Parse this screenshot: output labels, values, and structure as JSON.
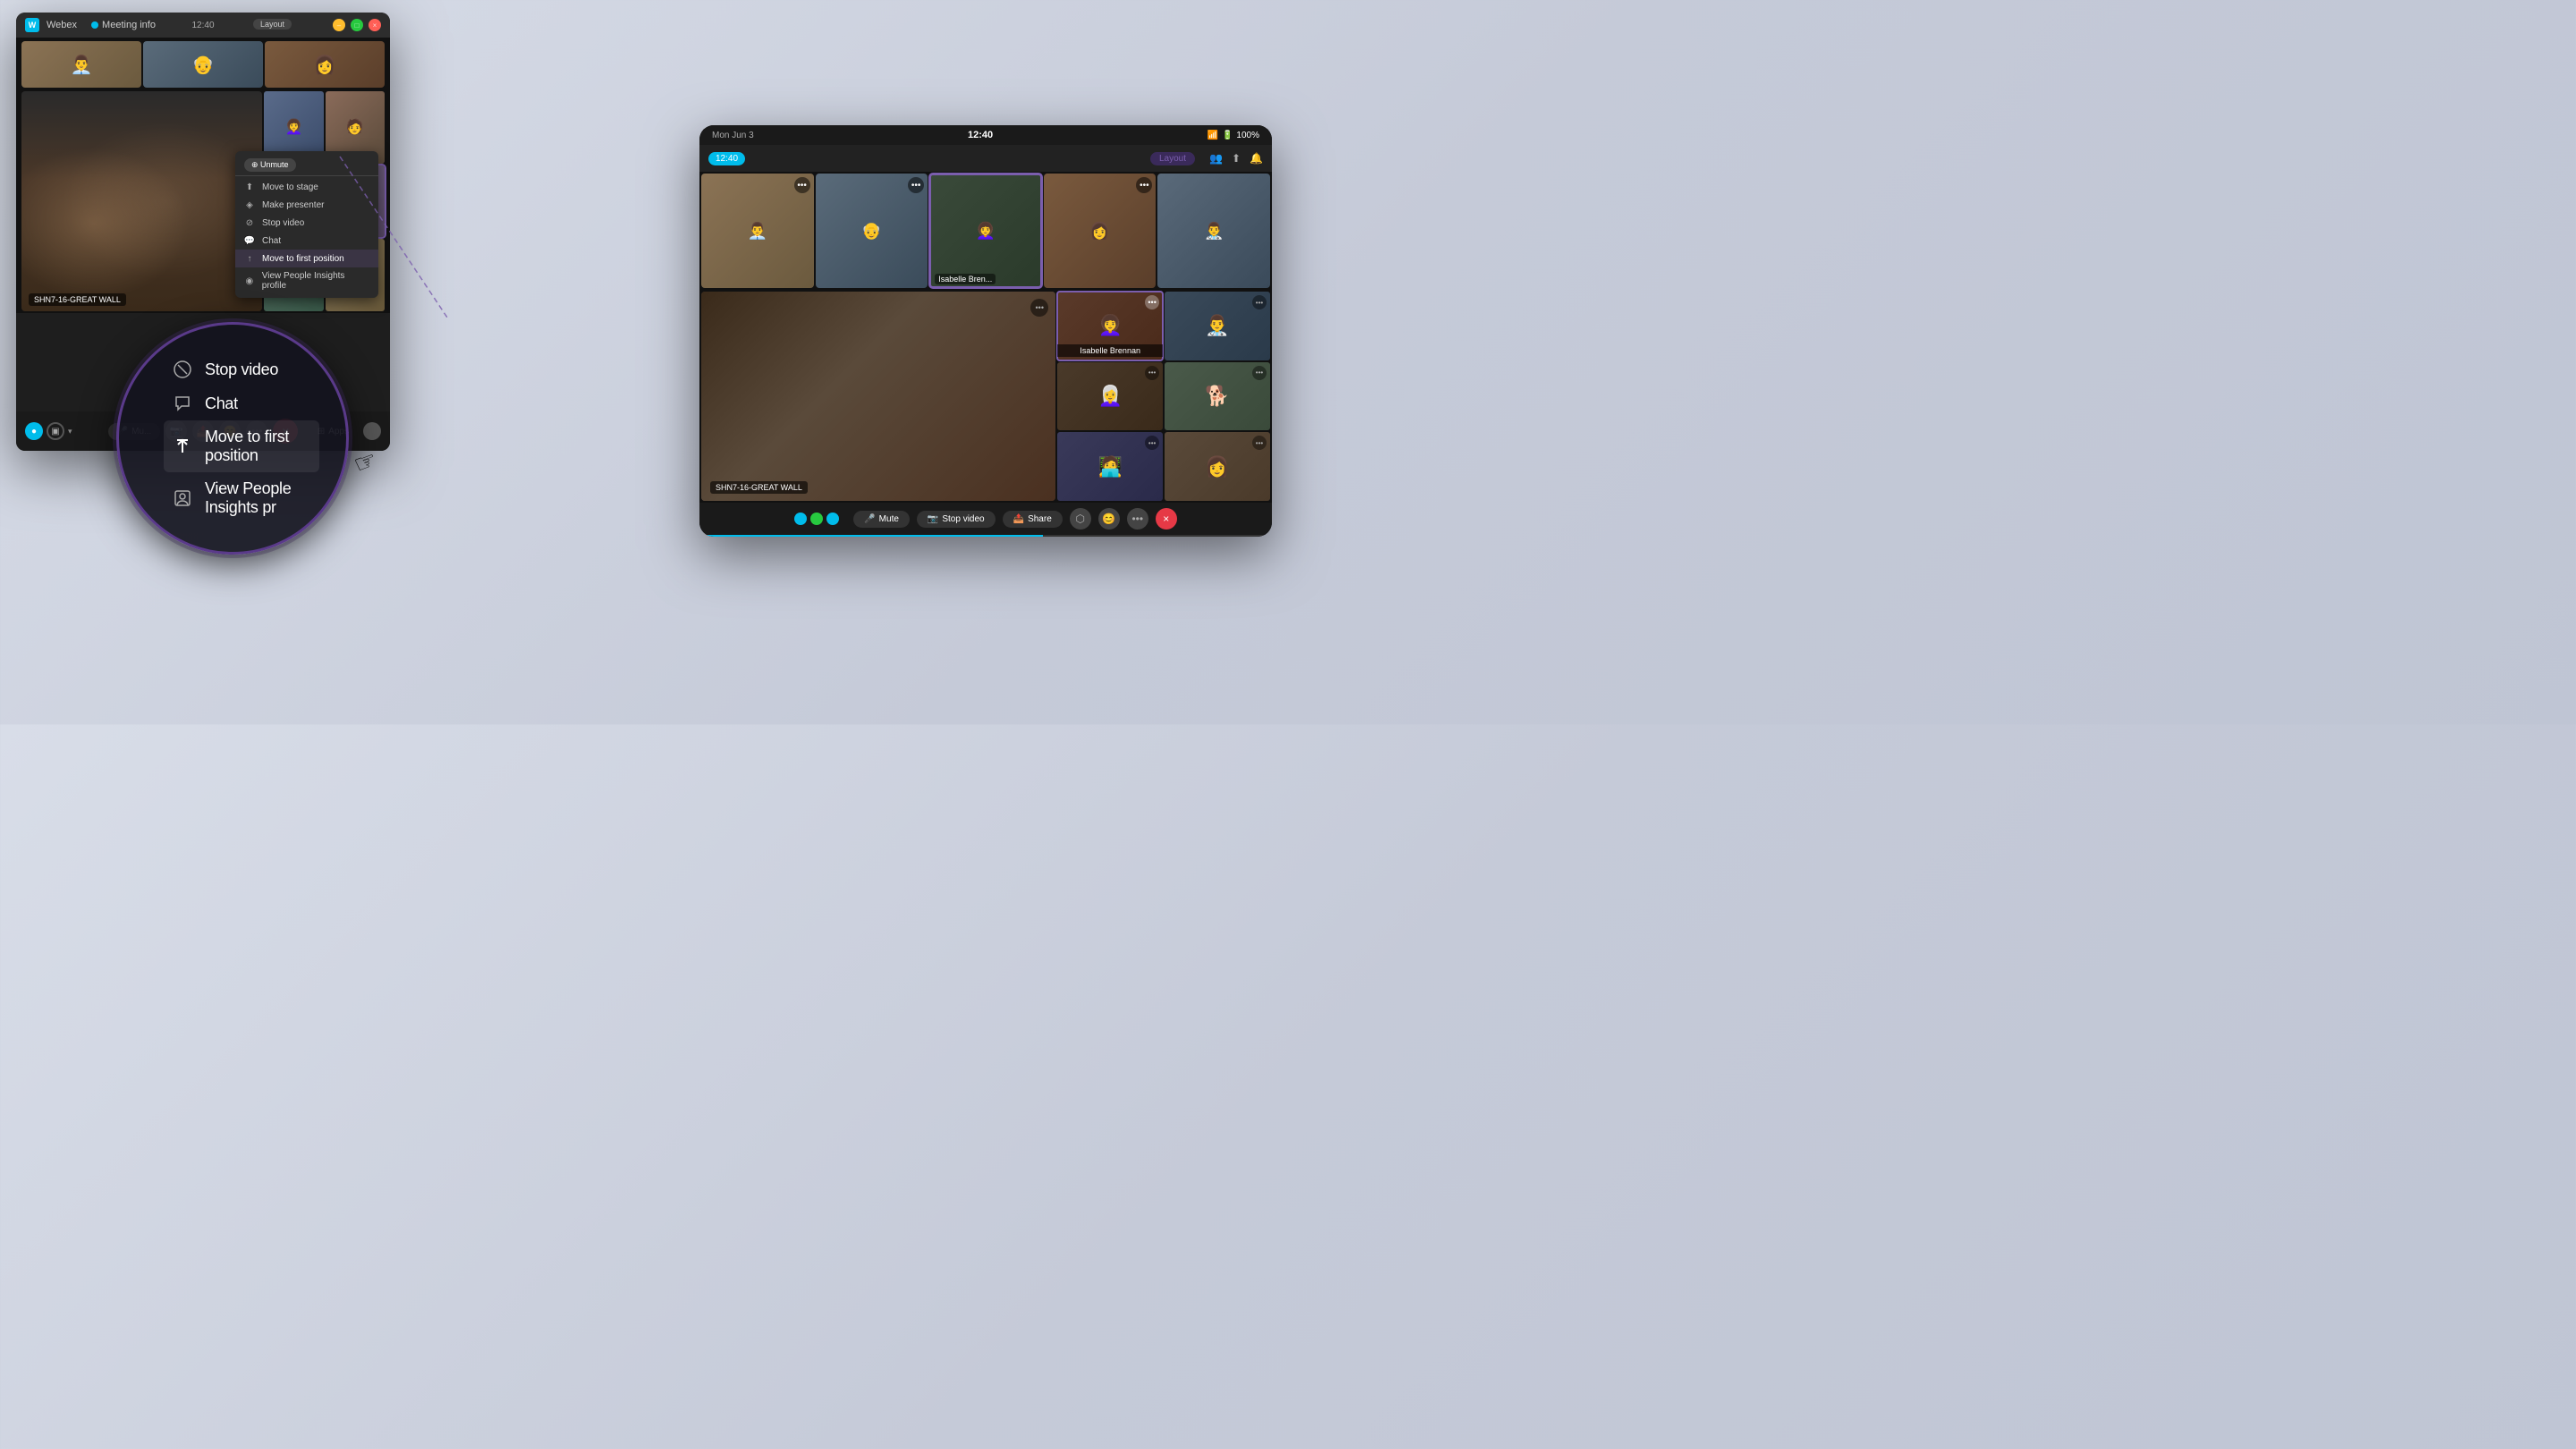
{
  "app": {
    "title": "Webex",
    "meeting_info": "Meeting info",
    "time": "12:40",
    "layout": "Layout"
  },
  "titlebar": {
    "close": "×",
    "minimize": "–",
    "maximize": "□"
  },
  "thumbnails": [
    {
      "id": "thumb-1",
      "css_class": "person-1"
    },
    {
      "id": "thumb-2",
      "css_class": "person-2"
    },
    {
      "id": "thumb-3",
      "css_class": "person-3"
    }
  ],
  "main_speaker": {
    "label": "SHN7-16-GREAT WALL"
  },
  "context_menu_small": {
    "unmute_label": "⊕ Unmute",
    "items": [
      {
        "id": "move-stage",
        "icon": "⬆",
        "label": "Move to stage"
      },
      {
        "id": "make-presenter",
        "icon": "◈",
        "label": "Make presenter"
      },
      {
        "id": "stop-video",
        "icon": "⊘",
        "label": "Stop video"
      },
      {
        "id": "chat",
        "icon": "💬",
        "label": "Chat"
      },
      {
        "id": "move-first",
        "icon": "↑",
        "label": "Move to first position"
      },
      {
        "id": "view-profile",
        "icon": "◉",
        "label": "View People Insights profile"
      }
    ]
  },
  "toolbar": {
    "mute_label": "Mu...",
    "apps_label": "Apps",
    "end_label": "×"
  },
  "circular_menu": {
    "items": [
      {
        "id": "stop-video",
        "icon": "⊘",
        "label": "Stop video"
      },
      {
        "id": "chat",
        "icon": "💬",
        "label": "Chat"
      },
      {
        "id": "move-first",
        "icon": "↑",
        "label": "Move to first position"
      },
      {
        "id": "view-insights",
        "icon": "◉",
        "label": "View People Insights pr"
      }
    ]
  },
  "ipad": {
    "time": "12:40",
    "date": "Mon Jun 3",
    "status": "100%",
    "layout_label": "Layout",
    "meeting_time": "12:40",
    "main_label": "SHN7-16-GREAT WALL",
    "active_name": "Isabelle Brennan",
    "thumbnails": [
      {
        "id": "t1",
        "css": "ipad-thumb-bg-1",
        "has_dots": true
      },
      {
        "id": "t2",
        "css": "ipad-thumb-bg-2",
        "has_dots": true
      },
      {
        "id": "t3",
        "css": "ipad-thumb-bg-3",
        "has_dots": false,
        "is_active": true,
        "name": "Isabelle Bren..."
      },
      {
        "id": "t4",
        "css": "ipad-thumb-bg-4",
        "has_dots": true
      },
      {
        "id": "t5",
        "css": "ipad-thumb-bg-5",
        "has_dots": false
      }
    ],
    "sidebar_cells": [
      {
        "id": "sc1",
        "css": "ipad-thumb-bg-1"
      },
      {
        "id": "sc2",
        "css": "ipad-thumb-bg-2"
      },
      {
        "id": "sc3",
        "css": "ipad-thumb-bg-3"
      },
      {
        "id": "sc4",
        "css": "ipad-thumb-bg-4"
      },
      {
        "id": "sc5",
        "css": "ipad-thumb-bg-1"
      },
      {
        "id": "sc6",
        "css": "ipad-thumb-bg-2"
      },
      {
        "id": "sc7",
        "css": "ipad-thumb-bg-3"
      },
      {
        "id": "sc8",
        "css": "ipad-thumb-bg-4"
      }
    ],
    "toolbar": {
      "mute_label": "Mute",
      "stop_video_label": "Stop video",
      "share_label": "Share"
    }
  }
}
